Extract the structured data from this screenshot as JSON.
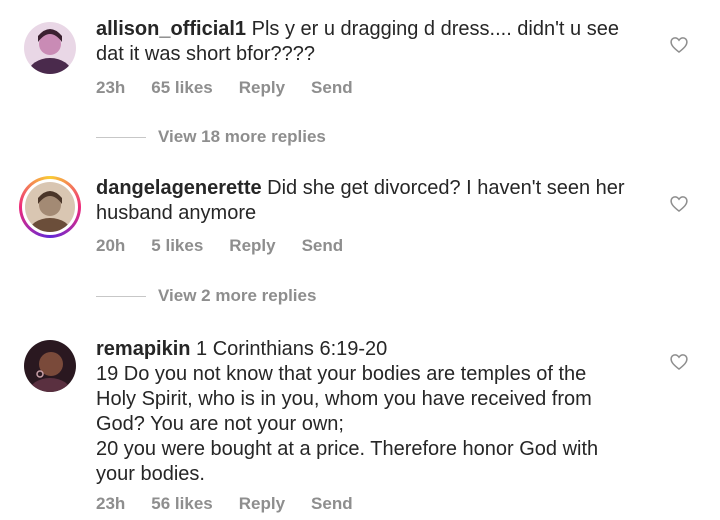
{
  "comments": [
    {
      "username": "allison_official1",
      "text": " Pls y er u dragging d dress.... didn't u see dat it was short bfor????",
      "time": "23h",
      "likes": "65 likes",
      "reply_label": "Reply",
      "send_label": "Send",
      "view_replies": "View 18 more replies",
      "avatar_colors": [
        "#e9d7e6",
        "#4a2a4c",
        "#c98bb5"
      ]
    },
    {
      "username": "dangelagenerette",
      "text": " Did she get divorced? I haven't seen her husband anymore",
      "time": "20h",
      "likes": "5 likes",
      "reply_label": "Reply",
      "send_label": "Send",
      "view_replies": "View 2 more replies",
      "avatar_colors": [
        "#d9c6b2",
        "#6b4e3a",
        "#a38a74"
      ]
    },
    {
      "username": "remapikin",
      "text": " 1 Corinthians 6:19-20",
      "lines": [
        "19 Do you not know that your bodies are temples of the",
        "Holy Spirit, who is in you, whom you have received from",
        "God? You are not your own;",
        "20 you were bought at a price. Therefore honor God with",
        "your bodies."
      ],
      "time": "23h",
      "likes": "56 likes",
      "reply_label": "Reply",
      "send_label": "Send",
      "avatar_colors": [
        "#2a1820",
        "#5a3040",
        "#c9a0a8"
      ]
    }
  ],
  "icons": {
    "like": "heart-outline-icon"
  },
  "colors": {
    "text": "#262626",
    "muted": "#8e8e8e",
    "divider": "#c7c7c7"
  }
}
